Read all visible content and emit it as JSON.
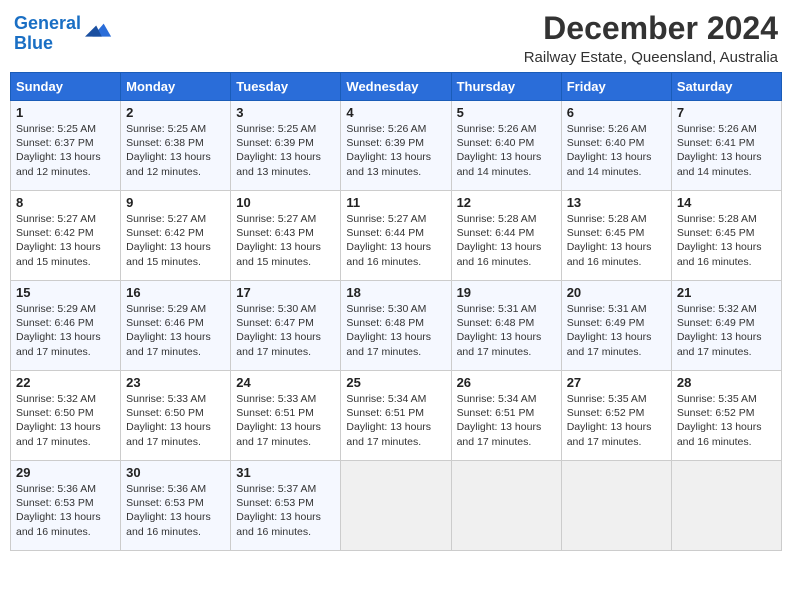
{
  "logo": {
    "line1": "General",
    "line2": "Blue"
  },
  "title": "December 2024",
  "subtitle": "Railway Estate, Queensland, Australia",
  "days_header": [
    "Sunday",
    "Monday",
    "Tuesday",
    "Wednesday",
    "Thursday",
    "Friday",
    "Saturday"
  ],
  "weeks": [
    [
      {
        "day": "1",
        "info": "Sunrise: 5:25 AM\nSunset: 6:37 PM\nDaylight: 13 hours\nand 12 minutes."
      },
      {
        "day": "2",
        "info": "Sunrise: 5:25 AM\nSunset: 6:38 PM\nDaylight: 13 hours\nand 12 minutes."
      },
      {
        "day": "3",
        "info": "Sunrise: 5:25 AM\nSunset: 6:39 PM\nDaylight: 13 hours\nand 13 minutes."
      },
      {
        "day": "4",
        "info": "Sunrise: 5:26 AM\nSunset: 6:39 PM\nDaylight: 13 hours\nand 13 minutes."
      },
      {
        "day": "5",
        "info": "Sunrise: 5:26 AM\nSunset: 6:40 PM\nDaylight: 13 hours\nand 14 minutes."
      },
      {
        "day": "6",
        "info": "Sunrise: 5:26 AM\nSunset: 6:40 PM\nDaylight: 13 hours\nand 14 minutes."
      },
      {
        "day": "7",
        "info": "Sunrise: 5:26 AM\nSunset: 6:41 PM\nDaylight: 13 hours\nand 14 minutes."
      }
    ],
    [
      {
        "day": "8",
        "info": "Sunrise: 5:27 AM\nSunset: 6:42 PM\nDaylight: 13 hours\nand 15 minutes."
      },
      {
        "day": "9",
        "info": "Sunrise: 5:27 AM\nSunset: 6:42 PM\nDaylight: 13 hours\nand 15 minutes."
      },
      {
        "day": "10",
        "info": "Sunrise: 5:27 AM\nSunset: 6:43 PM\nDaylight: 13 hours\nand 15 minutes."
      },
      {
        "day": "11",
        "info": "Sunrise: 5:27 AM\nSunset: 6:44 PM\nDaylight: 13 hours\nand 16 minutes."
      },
      {
        "day": "12",
        "info": "Sunrise: 5:28 AM\nSunset: 6:44 PM\nDaylight: 13 hours\nand 16 minutes."
      },
      {
        "day": "13",
        "info": "Sunrise: 5:28 AM\nSunset: 6:45 PM\nDaylight: 13 hours\nand 16 minutes."
      },
      {
        "day": "14",
        "info": "Sunrise: 5:28 AM\nSunset: 6:45 PM\nDaylight: 13 hours\nand 16 minutes."
      }
    ],
    [
      {
        "day": "15",
        "info": "Sunrise: 5:29 AM\nSunset: 6:46 PM\nDaylight: 13 hours\nand 17 minutes."
      },
      {
        "day": "16",
        "info": "Sunrise: 5:29 AM\nSunset: 6:46 PM\nDaylight: 13 hours\nand 17 minutes."
      },
      {
        "day": "17",
        "info": "Sunrise: 5:30 AM\nSunset: 6:47 PM\nDaylight: 13 hours\nand 17 minutes."
      },
      {
        "day": "18",
        "info": "Sunrise: 5:30 AM\nSunset: 6:48 PM\nDaylight: 13 hours\nand 17 minutes."
      },
      {
        "day": "19",
        "info": "Sunrise: 5:31 AM\nSunset: 6:48 PM\nDaylight: 13 hours\nand 17 minutes."
      },
      {
        "day": "20",
        "info": "Sunrise: 5:31 AM\nSunset: 6:49 PM\nDaylight: 13 hours\nand 17 minutes."
      },
      {
        "day": "21",
        "info": "Sunrise: 5:32 AM\nSunset: 6:49 PM\nDaylight: 13 hours\nand 17 minutes."
      }
    ],
    [
      {
        "day": "22",
        "info": "Sunrise: 5:32 AM\nSunset: 6:50 PM\nDaylight: 13 hours\nand 17 minutes."
      },
      {
        "day": "23",
        "info": "Sunrise: 5:33 AM\nSunset: 6:50 PM\nDaylight: 13 hours\nand 17 minutes."
      },
      {
        "day": "24",
        "info": "Sunrise: 5:33 AM\nSunset: 6:51 PM\nDaylight: 13 hours\nand 17 minutes."
      },
      {
        "day": "25",
        "info": "Sunrise: 5:34 AM\nSunset: 6:51 PM\nDaylight: 13 hours\nand 17 minutes."
      },
      {
        "day": "26",
        "info": "Sunrise: 5:34 AM\nSunset: 6:51 PM\nDaylight: 13 hours\nand 17 minutes."
      },
      {
        "day": "27",
        "info": "Sunrise: 5:35 AM\nSunset: 6:52 PM\nDaylight: 13 hours\nand 17 minutes."
      },
      {
        "day": "28",
        "info": "Sunrise: 5:35 AM\nSunset: 6:52 PM\nDaylight: 13 hours\nand 16 minutes."
      }
    ],
    [
      {
        "day": "29",
        "info": "Sunrise: 5:36 AM\nSunset: 6:53 PM\nDaylight: 13 hours\nand 16 minutes."
      },
      {
        "day": "30",
        "info": "Sunrise: 5:36 AM\nSunset: 6:53 PM\nDaylight: 13 hours\nand 16 minutes."
      },
      {
        "day": "31",
        "info": "Sunrise: 5:37 AM\nSunset: 6:53 PM\nDaylight: 13 hours\nand 16 minutes."
      },
      {
        "day": "",
        "info": ""
      },
      {
        "day": "",
        "info": ""
      },
      {
        "day": "",
        "info": ""
      },
      {
        "day": "",
        "info": ""
      }
    ]
  ]
}
